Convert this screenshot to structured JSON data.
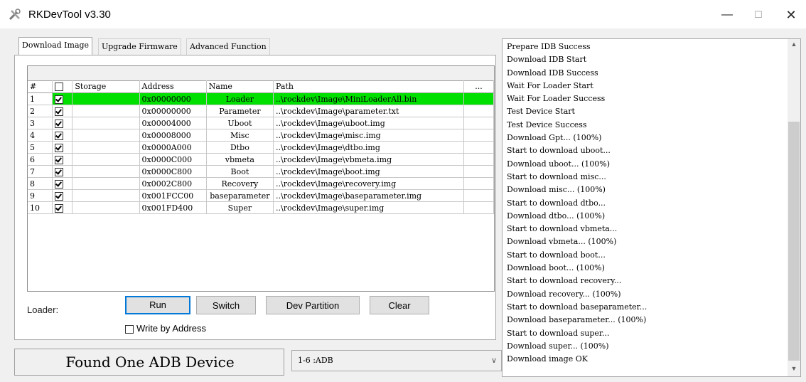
{
  "window": {
    "title": "RKDevTool v3.30"
  },
  "tabs": [
    {
      "label": "Download Image"
    },
    {
      "label": "Upgrade Firmware"
    },
    {
      "label": "Advanced Function"
    }
  ],
  "table": {
    "headers": [
      "#",
      "",
      "Storage",
      "Address",
      "Name",
      "Path",
      "..."
    ],
    "rows": [
      {
        "num": "1",
        "checked": true,
        "storage": "",
        "address": "0x00000000",
        "name": "Loader",
        "path": "..\\rockdev\\Image\\MiniLoaderAll.bin"
      },
      {
        "num": "2",
        "checked": true,
        "storage": "",
        "address": "0x00000000",
        "name": "Parameter",
        "path": "..\\rockdev\\Image\\parameter.txt"
      },
      {
        "num": "3",
        "checked": true,
        "storage": "",
        "address": "0x00004000",
        "name": "Uboot",
        "path": "..\\rockdev\\Image\\uboot.img"
      },
      {
        "num": "4",
        "checked": true,
        "storage": "",
        "address": "0x00008000",
        "name": "Misc",
        "path": "..\\rockdev\\Image\\misc.img"
      },
      {
        "num": "5",
        "checked": true,
        "storage": "",
        "address": "0x0000A000",
        "name": "Dtbo",
        "path": "..\\rockdev\\Image\\dtbo.img"
      },
      {
        "num": "6",
        "checked": true,
        "storage": "",
        "address": "0x0000C000",
        "name": "vbmeta",
        "path": "..\\rockdev\\Image\\vbmeta.img"
      },
      {
        "num": "7",
        "checked": true,
        "storage": "",
        "address": "0x0000C800",
        "name": "Boot",
        "path": "..\\rockdev\\Image\\boot.img"
      },
      {
        "num": "8",
        "checked": true,
        "storage": "",
        "address": "0x0002C800",
        "name": "Recovery",
        "path": "..\\rockdev\\Image\\recovery.img"
      },
      {
        "num": "9",
        "checked": true,
        "storage": "",
        "address": "0x001FCC00",
        "name": "baseparameter",
        "path": "..\\rockdev\\Image\\baseparameter.img"
      },
      {
        "num": "10",
        "checked": true,
        "storage": "",
        "address": "0x001FD400",
        "name": "Super",
        "path": "..\\rockdev\\Image\\super.img"
      }
    ]
  },
  "controls": {
    "loader_label": "Loader:",
    "run": "Run",
    "switch": "Switch",
    "dev_partition": "Dev Partition",
    "clear": "Clear",
    "write_by_address": "Write by Address"
  },
  "status": {
    "text": "Found One ADB Device"
  },
  "device_select": {
    "value": "1-6 :ADB"
  },
  "log": [
    "Prepare IDB Success",
    "Download IDB Start",
    "Download IDB Success",
    "Wait For Loader Start",
    "Wait For Loader Success",
    "Test Device Start",
    "Test Device Success",
    "Download Gpt... (100%)",
    "Start to download uboot...",
    "Download uboot... (100%)",
    "Start to download misc...",
    "Download misc... (100%)",
    "Start to download dtbo...",
    "Download dtbo... (100%)",
    "Start to download vbmeta...",
    "Download vbmeta... (100%)",
    "Start to download boot...",
    "Download boot... (100%)",
    "Start to download recovery...",
    "Download recovery... (100%)",
    "Start to download baseparameter...",
    "Download baseparameter... (100%)",
    "Start to download super...",
    "Download super... (100%)",
    "Download image OK"
  ],
  "colors": {
    "selected_row": "#00e000",
    "accent": "#0078d7"
  }
}
